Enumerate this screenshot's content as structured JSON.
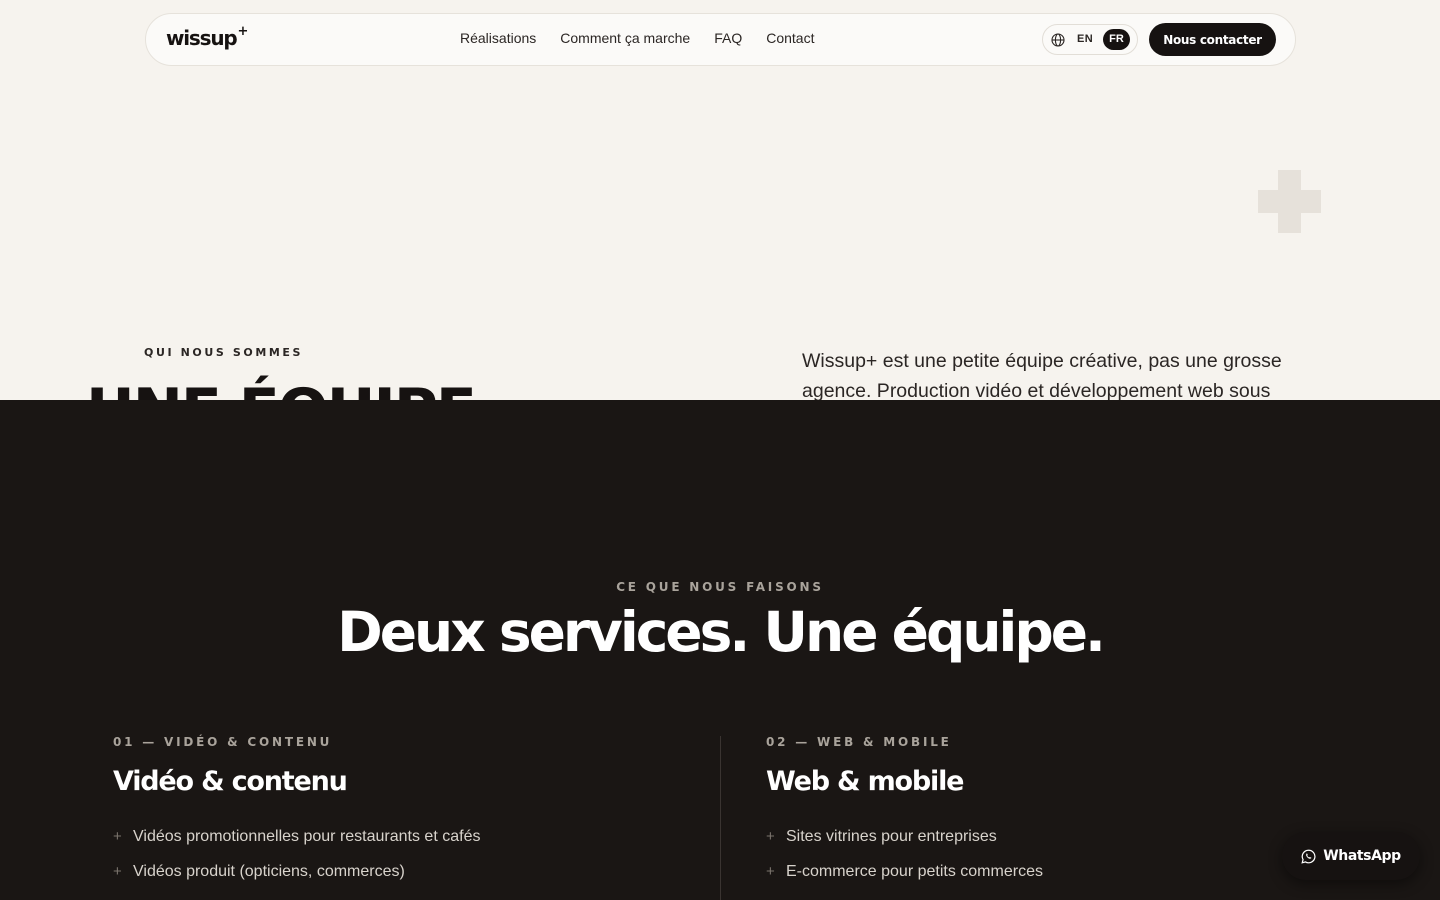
{
  "nav": {
    "logo": "wissup",
    "logo_sup": "+",
    "links": [
      "Réalisations",
      "Comment ça marche",
      "FAQ",
      "Contact"
    ],
    "lang_en": "EN",
    "lang_fr": "FR",
    "cta": "Nous contacter"
  },
  "about": {
    "eyebrow": "QUI NOUS SOMMES",
    "title": "UNE ÉQUIPE",
    "intro": "Wissup+ est une petite équipe créative, pas une grosse agence. Production vidéo et développement web sous"
  },
  "services": {
    "eyebrow": "CE QUE NOUS FAISONS",
    "title": "Deux services. Une équipe.",
    "columns": [
      {
        "eyebrow": "01 — VIDÉO & CONTENU",
        "title": "Vidéo & contenu",
        "items": [
          "Vidéos promotionnelles pour restaurants et cafés",
          "Vidéos produit (opticiens, commerces)"
        ]
      },
      {
        "eyebrow": "02 — WEB & MOBILE",
        "title": "Web & mobile",
        "items": [
          "Sites vitrines pour entreprises",
          "E-commerce pour petits commerces"
        ]
      }
    ],
    "bullet": "+"
  },
  "whatsapp": {
    "label": "WhatsApp"
  },
  "colors": {
    "light_bg": "#f6f3ee",
    "dark_bg": "#1a1614",
    "ink": "#161211",
    "plus_deco": "#e6e1da"
  }
}
